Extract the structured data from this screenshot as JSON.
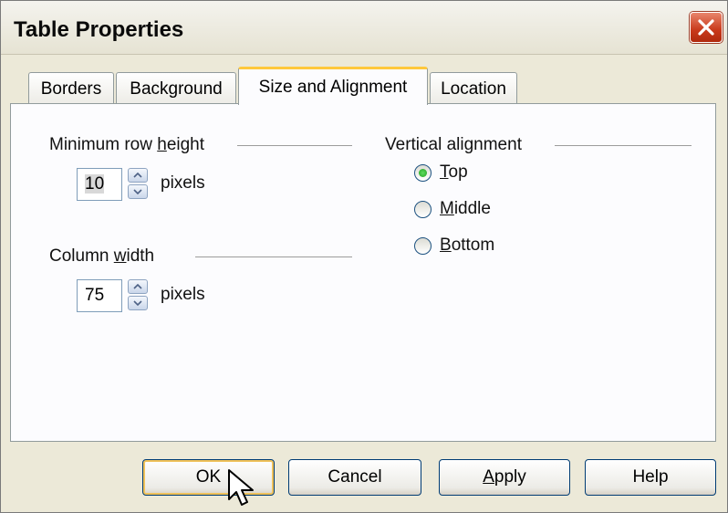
{
  "window": {
    "title": "Table Properties"
  },
  "tabs": [
    {
      "label": "Borders",
      "active": false
    },
    {
      "label": "Background",
      "active": false
    },
    {
      "label": "Size and Alignment",
      "active": true
    },
    {
      "label": "Location",
      "active": false
    }
  ],
  "row_height": {
    "label_pre": "Minimum row ",
    "label_accel": "h",
    "label_post": "eight",
    "value_sel": "10",
    "unit": "pixels"
  },
  "column_width": {
    "label_pre": "Column ",
    "label_accel": "w",
    "label_post": "idth",
    "value": "75",
    "unit": "pixels"
  },
  "vertical_alignment": {
    "label": "Vertical alignment",
    "options": [
      {
        "accel": "T",
        "rest": "op",
        "selected": true
      },
      {
        "accel": "M",
        "rest": "iddle",
        "selected": false
      },
      {
        "accel": "B",
        "rest": "ottom",
        "selected": false
      }
    ]
  },
  "buttons": {
    "ok": "OK",
    "cancel": "Cancel",
    "apply_accel": "A",
    "apply_rest": "pply",
    "help": "Help"
  },
  "icons": {
    "close": "close-icon",
    "spin_up": "arrow-up-icon",
    "spin_down": "arrow-down-icon",
    "cursor": "mouse-pointer-icon"
  },
  "colors": {
    "close_button": "#c8391b",
    "active_tab_highlight": "#ffc83c",
    "radio_selected": "#21a121",
    "focus_border": "#003c74"
  }
}
